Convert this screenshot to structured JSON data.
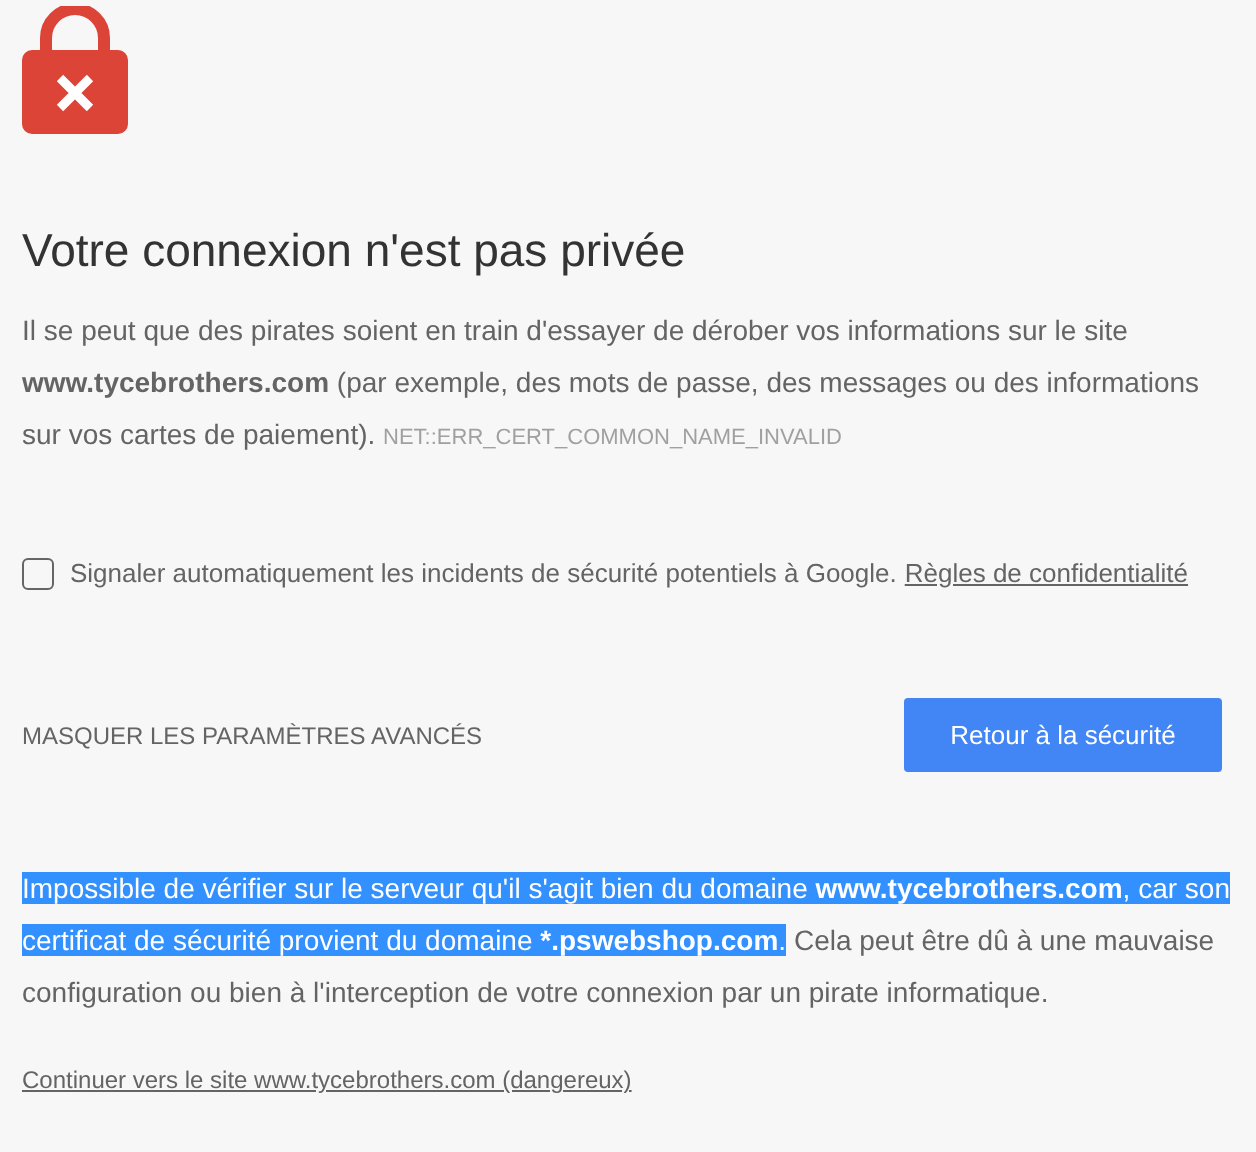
{
  "heading": "Votre connexion n'est pas privée",
  "intro": {
    "text": "Il se peut que des pirates soient en train d'essayer de dérober vos informations sur le site **www.tycebrothers.com** (par exemple, des mots de passe, des messages ou des informations sur vos cartes de paiement).",
    "error_code": "NET::ERR_CERT_COMMON_NAME_INVALID"
  },
  "report": {
    "checked": false,
    "label": "Signaler automatiquement les incidents de sécurité potentiels à Google.",
    "link": "Règles de confidentialité"
  },
  "advanced_toggle": "MASQUER LES PARAMÈTRES AVANCÉS",
  "back_button": "Retour à la sécurité",
  "details": [
    {
      "text": "Impossible de vérifier sur le serveur qu'il s'agit bien du domaine **www.tycebrothers.com**, car son certificat de sécurité provient du domaine ***.pswebshop.com**.",
      "selected": true
    },
    {
      "text": " Cela peut être dû à une mauvaise configuration ou bien à l'interception de votre connexion par un pirate informatique.",
      "selected": false
    }
  ],
  "proceed_link": "Continuer vers le site www.tycebrothers.com (dangereux)"
}
